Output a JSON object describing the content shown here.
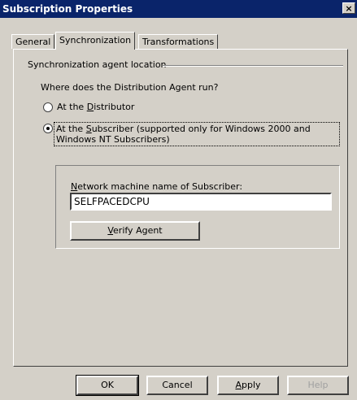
{
  "window": {
    "title": "Subscription Properties",
    "close_glyph": "×"
  },
  "tabs": [
    {
      "label": "General",
      "active": false
    },
    {
      "label": "Synchronization",
      "active": true
    },
    {
      "label": "Transformations",
      "active": false
    }
  ],
  "sync": {
    "group_label": "Synchronization agent location",
    "question": "Where does the Distribution Agent run?",
    "options": [
      {
        "pre": "At the ",
        "accel": "D",
        "post": "istributor",
        "checked": false
      },
      {
        "pre": "At the ",
        "accel": "S",
        "post": "ubscriber (supported only for Windows 2000 and Windows NT Subscribers)",
        "checked": true
      }
    ],
    "machine": {
      "label_accel": "N",
      "label_rest": "etwork machine name of Subscriber:",
      "value": "SELFPACEDCPU"
    },
    "verify": {
      "accel": "V",
      "rest": "erify Agent"
    }
  },
  "footer": {
    "ok": "OK",
    "cancel": "Cancel",
    "apply": {
      "accel": "A",
      "rest": "pply"
    },
    "help": "Help"
  }
}
